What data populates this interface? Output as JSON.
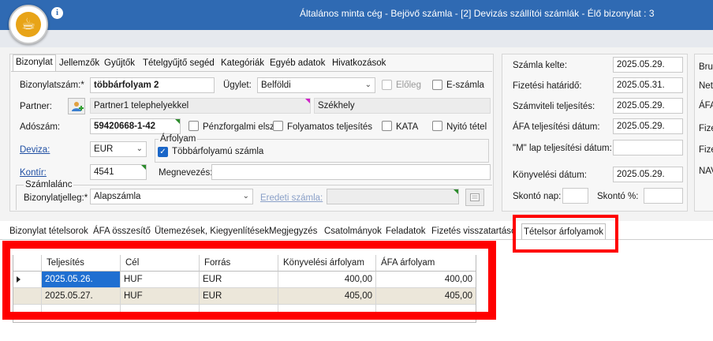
{
  "window": {
    "title": "Általános minta cég - Bejövő számla -  [2] Devizás szállítói számlák - Élő bizonylat : 3"
  },
  "colors": {
    "titlebar": "#2f6ab3",
    "highlight": "#ff0000",
    "selection": "#1f6fd1",
    "alt_row": "#ece7da"
  },
  "top_tabs": [
    "Bizonylat",
    "Jellemzők",
    "Gyűjtők",
    "Tételgyűjtő segéd",
    "Kategóriák",
    "Egyéb adatok",
    "Hivatkozások"
  ],
  "form": {
    "bizonylatszam_label": "Bizonylatszám:*",
    "bizonylatszam_value": "többárfolyam 2",
    "ugylet_label": "Ügylet:",
    "ugylet_value": "Belföldi",
    "eloleg_label": "Előleg",
    "eszamla_label": "E-számla",
    "partner_label": "Partner:",
    "partner_value": "Partner1 telephelyekkel",
    "partner_site": "Székhely",
    "adoszam_label": "Adószám:",
    "adoszam_value": "59420668-1-42",
    "penzforgalmi_label": "Pénzforgalmi elsz.",
    "folyamatos_label": "Folyamatos teljesítés",
    "kata_label": "KATA",
    "nyito_label": "Nyitó tétel",
    "deviza_label": "Deviza:",
    "deviza_value": "EUR",
    "arfolyam_group": "Árfolyam",
    "tobbarfolyam_label": "Többárfolyamú számla",
    "kontir_label": "Kontír:",
    "kontir_value": "4541",
    "megnevezes_label": "Megnevezés:",
    "szamlalanc_group": "Számlalánc",
    "bizonylatjelleg_label": "Bizonylatjelleg:*",
    "bizonylatjelleg_value": "Alapszámla",
    "eredeti_label": "Eredeti számla:"
  },
  "dates": {
    "szamla_kelte_label": "Számla kelte:",
    "szamla_kelte": "2025.05.29.",
    "fizetesi_hatarido_label": "Fizetési határidő:",
    "fizetesi_hatarido": "2025.05.31.",
    "szamviteli_label": "Számviteli teljesítés:",
    "szamviteli": "2025.05.29.",
    "afa_teljesitesi_label": "ÁFA teljesítési dátum:",
    "afa_teljesitesi": "2025.05.29.",
    "m_lap_label": "\"M\" lap teljesítési dátum:",
    "m_lap": "",
    "konyvelesi_label": "Könyvelési dátum:",
    "konyvelesi": "2025.05.29.",
    "skonto_nap_label": "Skontó nap:",
    "skonto_nap": "",
    "skonto_pct_label": "Skontó %:",
    "skonto_pct": ""
  },
  "far_labels": [
    "Bru",
    "Net",
    "ÁFA",
    "Fize",
    "Fize",
    "NAV"
  ],
  "bottom_tabs": [
    "Bizonylat tételsorok",
    "ÁFA összesítő",
    "Ütemezések, Kiegyenlítések",
    "Megjegyzés",
    "Csatolmányok",
    "Feladatok",
    "Fizetés visszatartáso",
    "Tételsor árfolyamok"
  ],
  "grid": {
    "columns": [
      "Teljesítés",
      "Cél",
      "Forrás",
      "Könyvelési árfolyam",
      "ÁFA árfolyam"
    ],
    "rows": [
      [
        "2025.05.26.",
        "HUF",
        "EUR",
        "400,00",
        "400,00"
      ],
      [
        "2025.05.27.",
        "HUF",
        "EUR",
        "405,00",
        "405,00"
      ]
    ]
  }
}
